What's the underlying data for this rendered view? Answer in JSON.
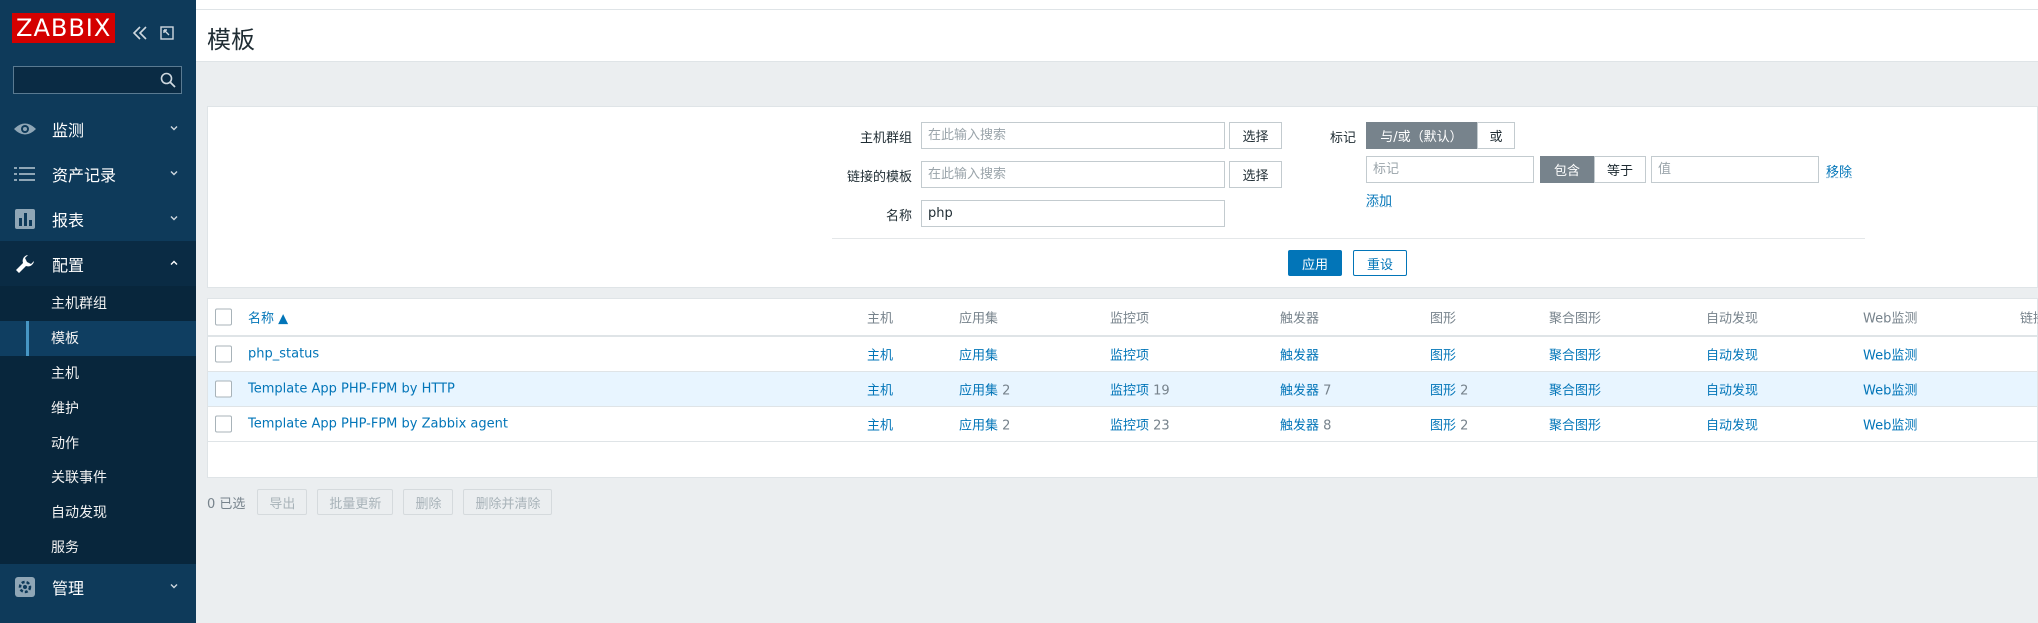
{
  "app": {
    "logo": "ZABBIX",
    "sidebar_search": {
      "value": "",
      "placeholder": ""
    }
  },
  "sidebar": {
    "menu": [
      {
        "label": "监测",
        "icon": "eye-icon",
        "expanded": false
      },
      {
        "label": "资产记录",
        "icon": "list-icon",
        "expanded": false
      },
      {
        "label": "报表",
        "icon": "bar-chart-icon",
        "expanded": false
      },
      {
        "label": "配置",
        "icon": "wrench-icon",
        "expanded": true
      },
      {
        "label": "管理",
        "icon": "gear-icon",
        "expanded": false
      }
    ],
    "config_submenu": [
      "主机群组",
      "模板",
      "主机",
      "维护",
      "动作",
      "关联事件",
      "自动发现",
      "服务"
    ],
    "selected_submenu": "模板"
  },
  "page": {
    "title": "模板"
  },
  "filter": {
    "host_groups": {
      "label": "主机群组",
      "placeholder": "在此输入搜索",
      "select_label": "选择"
    },
    "linked_templates": {
      "label": "链接的模板",
      "placeholder": "在此输入搜索",
      "select_label": "选择"
    },
    "name": {
      "label": "名称",
      "value": "php"
    },
    "tags": {
      "label": "标记",
      "eval_options": [
        "与/或（默认）",
        "或"
      ],
      "eval_selected": "与/或（默认）",
      "tag_placeholder": "标记",
      "operators": [
        "包含",
        "等于"
      ],
      "operator_selected": "包含",
      "value_placeholder": "值",
      "remove_label": "移除",
      "add_label": "添加"
    },
    "apply_label": "应用",
    "reset_label": "重设"
  },
  "table": {
    "columns": [
      "名称 ▲",
      "主机",
      "应用集",
      "监控项",
      "触发器",
      "图形",
      "聚合图形",
      "自动发现",
      "Web监测",
      "链接"
    ],
    "rows": [
      {
        "name": "php_status",
        "hosts": "主机",
        "applications": {
          "label": "应用集",
          "count": ""
        },
        "items": {
          "label": "监控项",
          "count": ""
        },
        "triggers": {
          "label": "触发器",
          "count": ""
        },
        "graphs": {
          "label": "图形",
          "count": ""
        },
        "screens": "聚合图形",
        "discovery": "自动发现",
        "web": "Web监测"
      },
      {
        "name": "Template App PHP-FPM by HTTP",
        "hosts": "主机",
        "applications": {
          "label": "应用集",
          "count": "2"
        },
        "items": {
          "label": "监控项",
          "count": "19"
        },
        "triggers": {
          "label": "触发器",
          "count": "7"
        },
        "graphs": {
          "label": "图形",
          "count": "2"
        },
        "screens": "聚合图形",
        "discovery": "自动发现",
        "web": "Web监测"
      },
      {
        "name": "Template App PHP-FPM by Zabbix agent",
        "hosts": "主机",
        "applications": {
          "label": "应用集",
          "count": "2"
        },
        "items": {
          "label": "监控项",
          "count": "23"
        },
        "triggers": {
          "label": "触发器",
          "count": "8"
        },
        "graphs": {
          "label": "图形",
          "count": "2"
        },
        "screens": "聚合图形",
        "discovery": "自动发现",
        "web": "Web监测"
      }
    ]
  },
  "footer": {
    "selected_count": "0 已选",
    "actions": [
      "导出",
      "批量更新",
      "删除",
      "删除并清除"
    ]
  },
  "colors": {
    "sidebar_bg": "#0e3a5a",
    "brand_red": "#d40000",
    "link": "#0275b8",
    "row_highlight": "#e8f5ff"
  }
}
